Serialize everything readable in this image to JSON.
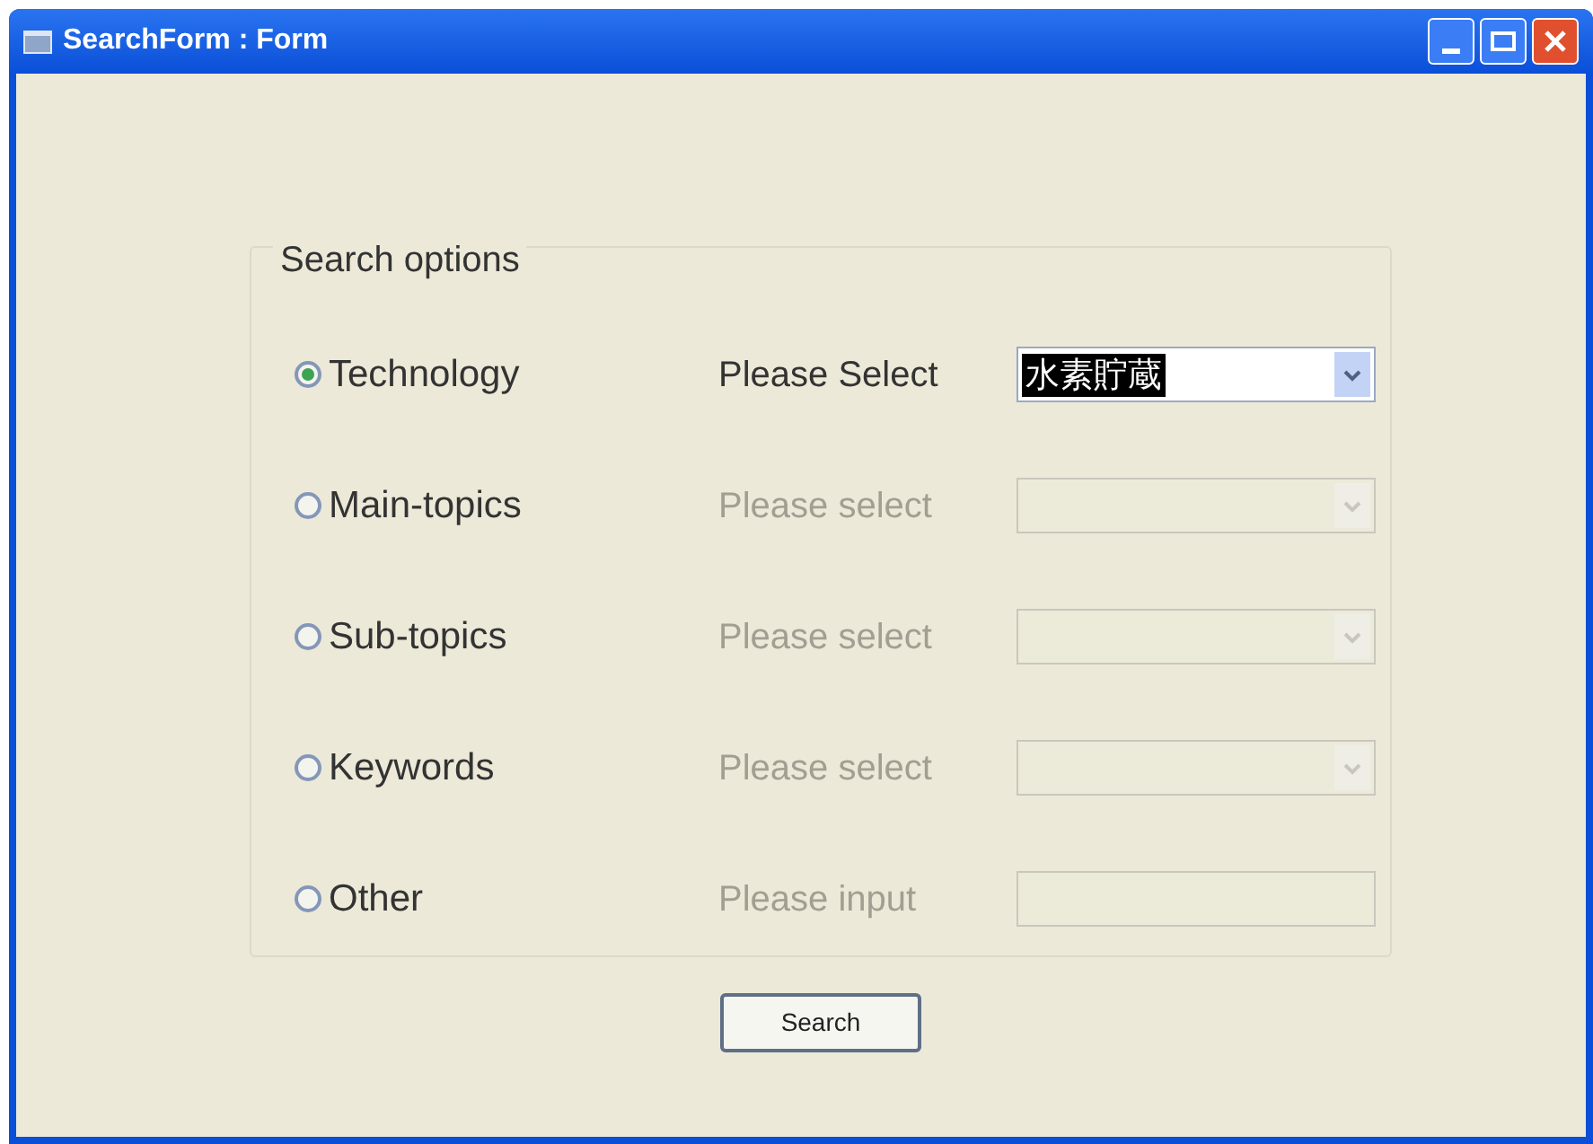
{
  "window": {
    "title": "SearchForm : Form"
  },
  "group": {
    "title": "Search options"
  },
  "options": [
    {
      "label": "Technology",
      "selected": true,
      "disabled": false,
      "kind": "select",
      "prompt": "Please Select",
      "value": "水素貯蔵",
      "value_highlighted": true
    },
    {
      "label": "Main-topics",
      "selected": false,
      "disabled": true,
      "kind": "select",
      "prompt": "Please select"
    },
    {
      "label": "Sub-topics",
      "selected": false,
      "disabled": true,
      "kind": "select",
      "prompt": "Please select"
    },
    {
      "label": "Keywords",
      "selected": false,
      "disabled": true,
      "kind": "select",
      "prompt": "Please select"
    },
    {
      "label": "Other",
      "selected": false,
      "disabled": true,
      "kind": "input",
      "prompt": "Please input"
    }
  ],
  "search_button": {
    "label": "Search"
  }
}
